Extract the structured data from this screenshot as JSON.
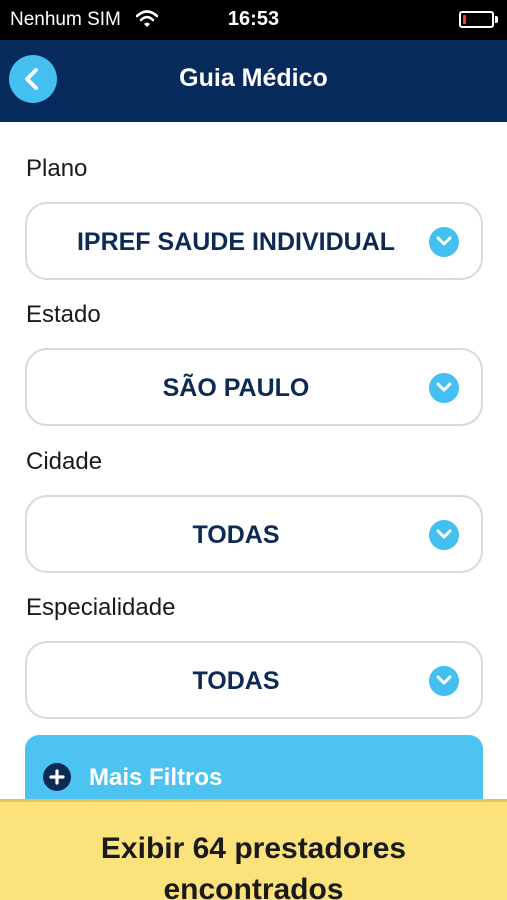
{
  "status_bar": {
    "carrier": "Nenhum SIM",
    "time": "16:53",
    "battery_level": 0.1
  },
  "nav": {
    "title": "Guia Médico",
    "back_icon": "chevron-left-icon"
  },
  "form": {
    "plano": {
      "label": "Plano",
      "value": "IPREF SAUDE INDIVIDUAL"
    },
    "estado": {
      "label": "Estado",
      "value": "SÃO PAULO"
    },
    "cidade": {
      "label": "Cidade",
      "value": "TODAS"
    },
    "especialidade": {
      "label": "Especialidade",
      "value": "TODAS"
    }
  },
  "filters": {
    "label": "Mais Filtros",
    "icon": "plus-circle-icon"
  },
  "results": {
    "line1": "Exibir 64 prestadores",
    "line2": "encontrados"
  },
  "colors": {
    "nav_background": "#062a5c",
    "accent_blue": "#43bff0",
    "value_text": "#0d2a56",
    "results_background": "#fbe27b"
  }
}
